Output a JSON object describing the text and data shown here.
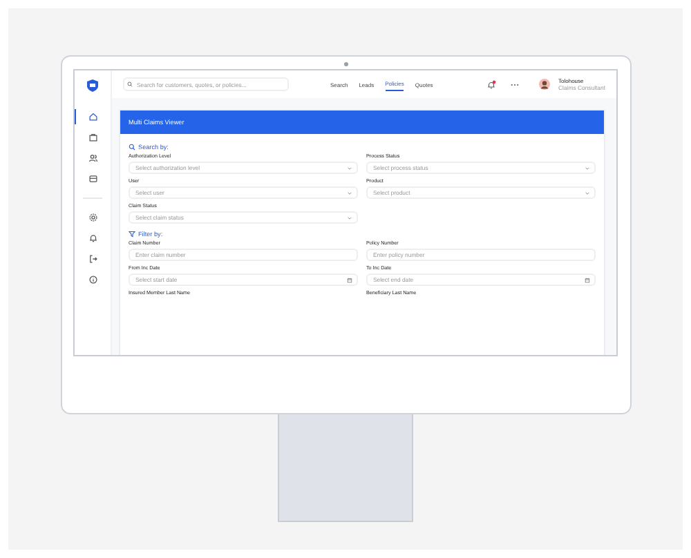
{
  "sidebar": {
    "items": [
      {
        "selected": true
      },
      {
        "selected": false
      },
      {
        "selected": false
      },
      {
        "selected": false
      },
      {
        "selected": false
      },
      {
        "selected": false
      },
      {
        "selected": false
      },
      {
        "selected": false
      }
    ]
  },
  "topbar": {
    "search": {
      "placeholder": "Search for customers, quotes, or policies..."
    },
    "nav": [
      {
        "label": "Search",
        "selected": false
      },
      {
        "label": "Leads",
        "selected": false
      },
      {
        "label": "Policies",
        "selected": true
      },
      {
        "label": "Quotes",
        "selected": false
      }
    ],
    "user": {
      "name": "Tolohouse",
      "role": "Claims Consultant"
    }
  },
  "page_title": "Multi Claims Viewer",
  "sections": [
    {
      "title": "Search by:",
      "fields": [
        {
          "label": "Authorization Level",
          "placeholder": "Select authorization level",
          "kind": "select"
        },
        {
          "label": "Process Status",
          "placeholder": "Select process status",
          "kind": "select"
        },
        {
          "label": "User",
          "placeholder": "Select user",
          "kind": "select"
        },
        {
          "label": "Product",
          "placeholder": "Select product",
          "kind": "select"
        },
        {
          "label": "Claim Status",
          "placeholder": "Select claim status",
          "kind": "select"
        }
      ]
    },
    {
      "title": "Filter by:",
      "fields": [
        {
          "label": "Claim Number",
          "placeholder": "Enter claim number",
          "kind": "text"
        },
        {
          "label": "Policy Number",
          "placeholder": "Enter policy number",
          "kind": "text"
        },
        {
          "label": "From Inc Date",
          "placeholder": "Select start date",
          "kind": "date"
        },
        {
          "label": "To Inc Date",
          "placeholder": "Select end date",
          "kind": "date"
        },
        {
          "label": "Insured Member Last Name",
          "kind": "cut"
        },
        {
          "label": "Beneficiary Last Name",
          "kind": "cut"
        }
      ]
    }
  ]
}
